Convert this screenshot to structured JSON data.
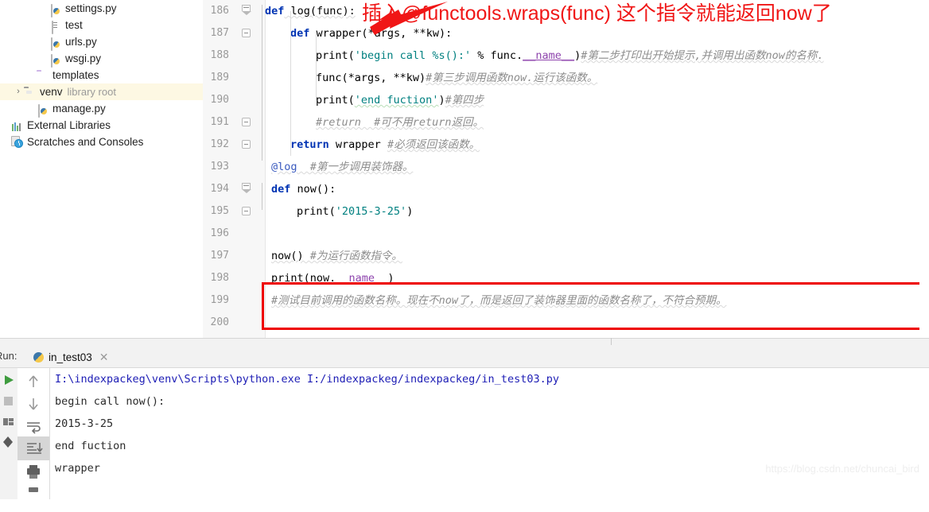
{
  "project_tree": {
    "items": [
      {
        "label": "settings.py",
        "icon": "python-file-icon",
        "indent": 3,
        "arrow": "",
        "sub": "",
        "highlight": false
      },
      {
        "label": "test",
        "icon": "text-file-icon",
        "indent": 3,
        "arrow": "",
        "sub": "",
        "highlight": false
      },
      {
        "label": "urls.py",
        "icon": "python-file-icon",
        "indent": 3,
        "arrow": "",
        "sub": "",
        "highlight": false
      },
      {
        "label": "wsgi.py",
        "icon": "python-file-icon",
        "indent": 3,
        "arrow": "",
        "sub": "",
        "highlight": false
      },
      {
        "label": "templates",
        "icon": "folder-icon",
        "indent": 2,
        "arrow": "",
        "sub": "",
        "highlight": false
      },
      {
        "label": "venv",
        "icon": "folder-grey-icon",
        "indent": 1,
        "arrow": "›",
        "sub": "library root",
        "highlight": true
      },
      {
        "label": "manage.py",
        "icon": "python-file-icon",
        "indent": 2,
        "arrow": "",
        "sub": "",
        "highlight": false
      },
      {
        "label": "External Libraries",
        "icon": "libraries-bars-icon",
        "indent": 0,
        "arrow": "",
        "sub": "",
        "highlight": false
      },
      {
        "label": "Scratches and Consoles",
        "icon": "scratches-icon",
        "indent": 0,
        "arrow": "",
        "sub": "",
        "highlight": false
      }
    ]
  },
  "editor": {
    "lines": [
      {
        "num": "186",
        "fold": "tri"
      },
      {
        "num": "187",
        "fold": "sq"
      },
      {
        "num": "188",
        "fold": ""
      },
      {
        "num": "189",
        "fold": ""
      },
      {
        "num": "190",
        "fold": ""
      },
      {
        "num": "191",
        "fold": "sq"
      },
      {
        "num": "192",
        "fold": "sq"
      },
      {
        "num": "193",
        "fold": ""
      },
      {
        "num": "194",
        "fold": "tri"
      },
      {
        "num": "195",
        "fold": "sq"
      },
      {
        "num": "196",
        "fold": ""
      },
      {
        "num": "197",
        "fold": ""
      },
      {
        "num": "198",
        "fold": ""
      },
      {
        "num": "199",
        "fold": ""
      },
      {
        "num": "200",
        "fold": ""
      }
    ],
    "code": {
      "l186_kw": "def",
      "l186_rest": " log(func):",
      "l187_kw": "def",
      "l187_rest": " wrapper(*args, **kw):",
      "l188_a": "print(",
      "l188_str": "'begin call %s():'",
      "l188_b": " % func.",
      "l188_dunder": "__name__",
      "l188_c": ")",
      "l188_cmt": "#第二步打印出开始提示,并调用出函数now的名称.",
      "l189_a": "func(*args, **kw)",
      "l189_cmt": "#第三步调用函数now.运行该函数。",
      "l190_a": "print(",
      "l190_str": "'end fuction'",
      "l190_b": ")",
      "l190_cmt": "#第四步",
      "l191_cmt": "#return  #可不用return返回。",
      "l192_kw": "return",
      "l192_rest": " wrapper ",
      "l192_cmt": "#必须返回该函数。",
      "l193_deco": "@log",
      "l193_cmt": "  #第一步调用装饰器。",
      "l194_kw": "def",
      "l194_rest": " now():",
      "l195_a": "print(",
      "l195_str": "'2015-3-25'",
      "l195_b": ")",
      "l197_a": "now() ",
      "l197_cmt": "#为运行函数指令。",
      "l198_a": "print(now.",
      "l198_dunder": "__name__",
      "l198_b": ")",
      "l199_cmt": "#测试目前调用的函数名称。现在不now了，而是返回了装饰器里面的函数名称了，不符合预期。"
    }
  },
  "annotation": {
    "text": "插入@functools.wraps(func) 这个指令就能返回now了",
    "color": "#f01616",
    "arrow_name": "red-pointer-arrow",
    "box_color": "#ee0000"
  },
  "run_panel": {
    "label": "Run:",
    "tab_name": "in_test03",
    "close_glyph": "✕",
    "console_lines": [
      {
        "text": "I:\\indexpackeg\\venv\\Scripts\\python.exe I:/indexpackeg/indexpackeg/in_test03.py",
        "style": "path"
      },
      {
        "text": "begin call now():",
        "style": "normal"
      },
      {
        "text": "2015-3-25",
        "style": "normal"
      },
      {
        "text": "end fuction",
        "style": "normal"
      },
      {
        "text": "wrapper",
        "style": "normal"
      }
    ],
    "toolbar_icons": [
      "run-icon",
      "stop-icon",
      "layout-icon",
      "pin-icon"
    ],
    "toolbar2_icons": [
      "scroll-up-icon",
      "scroll-down-icon",
      "soft-wrap-icon",
      "scroll-to-end-icon",
      "print-icon",
      "clear-all-icon"
    ]
  },
  "watermark": {
    "text": "https://blog.csdn.net/chuncai_bird"
  }
}
